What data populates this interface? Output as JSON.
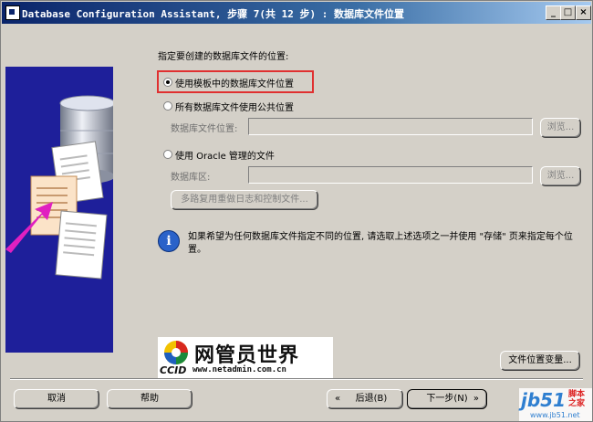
{
  "window": {
    "title": "Database Configuration Assistant, 步骤 7(共 12 步) : 数据库文件位置",
    "controls": {
      "minimize": "_",
      "maximize": "□",
      "close": "×"
    }
  },
  "main": {
    "prompt": "指定要创建的数据库文件的位置:",
    "options": [
      {
        "label": "使用模板中的数据库文件位置",
        "selected": true
      },
      {
        "label": "所有数据库文件使用公共位置",
        "selected": false
      },
      {
        "label": "使用 Oracle 管理的文件",
        "selected": false
      }
    ],
    "db_file_location_label": "数据库文件位置:",
    "db_area_label": "数据库区:",
    "browse_label": "浏览...",
    "multiplex_label": "多路复用重做日志和控制文件...",
    "info_text": "如果希望为任何数据库文件指定不同的位置, 请选取上述选项之一并使用 \"存储\" 页来指定每个位置。",
    "file_location_vars_label": "文件位置变量..."
  },
  "logo": {
    "name": "网管员世界",
    "ccid": "CCID",
    "url": "www.netadmin.com.cn"
  },
  "watermark": {
    "main": "jb51",
    "side": "脚本之家",
    "url": "www.jb51.net"
  },
  "footer": {
    "cancel": "取消",
    "help": "帮助",
    "back": "后退(B)",
    "next": "下一步(N)"
  },
  "colors": {
    "title_bar": "#0a246a",
    "highlight": "#e03030",
    "illustration_bg": "#1e1f9a",
    "arrow": "#e020c0"
  }
}
